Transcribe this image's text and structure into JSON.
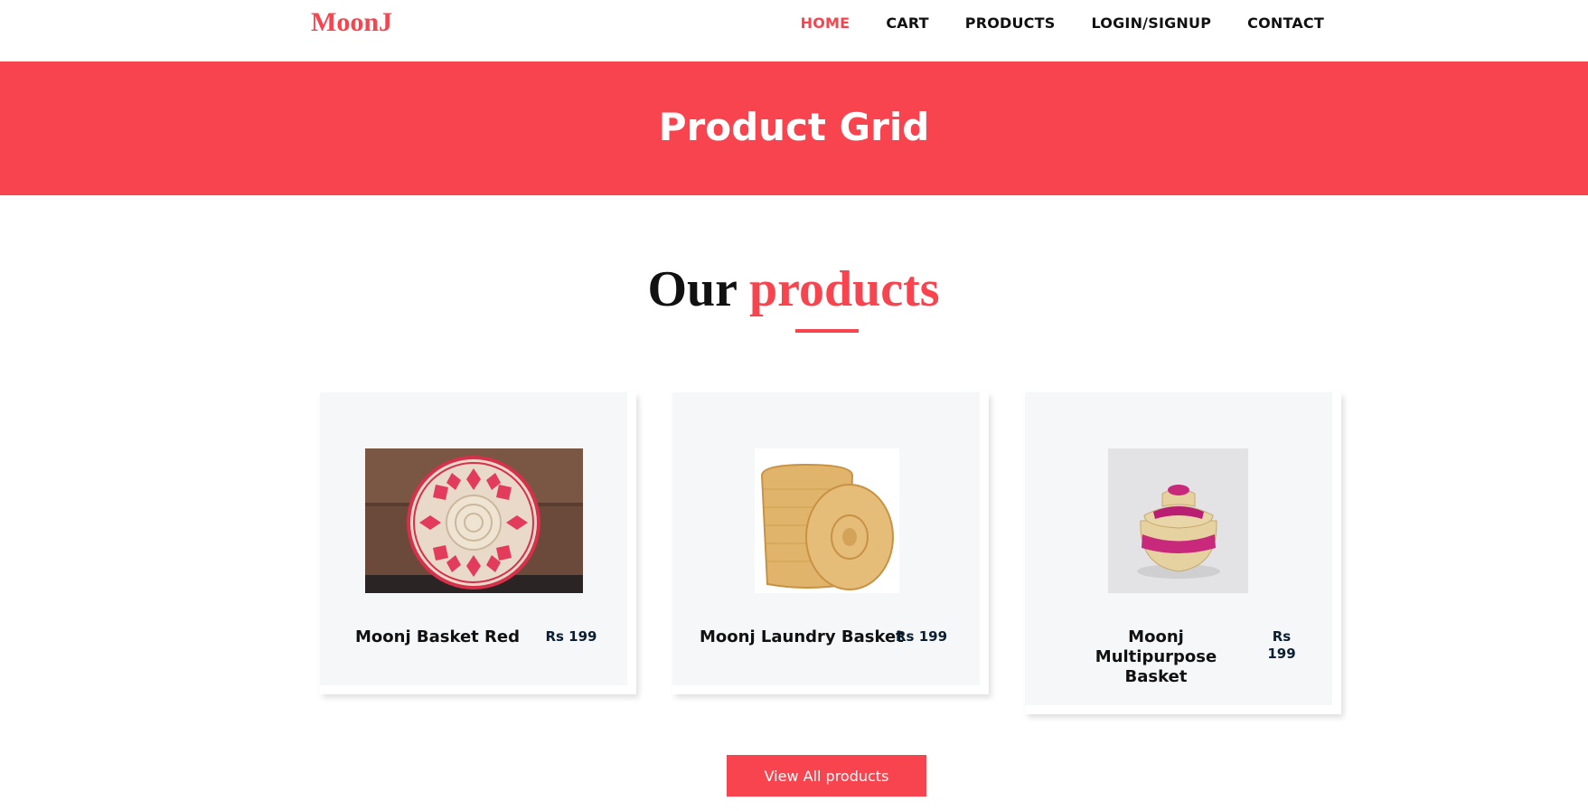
{
  "brand": {
    "logo": "MoonJ",
    "accent_color": "#f7444e"
  },
  "nav": {
    "items": [
      {
        "label": "HOME",
        "active": true
      },
      {
        "label": "CART",
        "active": false
      },
      {
        "label": "PRODUCTS",
        "active": false
      },
      {
        "label": "LOGIN/SIGNUP",
        "active": false
      },
      {
        "label": "CONTACT",
        "active": false
      }
    ]
  },
  "banner": {
    "title": "Product Grid"
  },
  "section": {
    "title_part1": "Our",
    "title_part2": "products"
  },
  "products": [
    {
      "name": "Moonj Basket Red",
      "price": "Rs 199",
      "image": "round-red-white-moonj-basket-image"
    },
    {
      "name": "Moonj Laundry Basket",
      "price": "Rs 199",
      "image": "laundry-basket-with-lid-image"
    },
    {
      "name": "Moonj Multipurpose Basket",
      "price": "Rs 199",
      "image": "pink-multipurpose-basket-image"
    }
  ],
  "cta": {
    "label": "View All products"
  }
}
